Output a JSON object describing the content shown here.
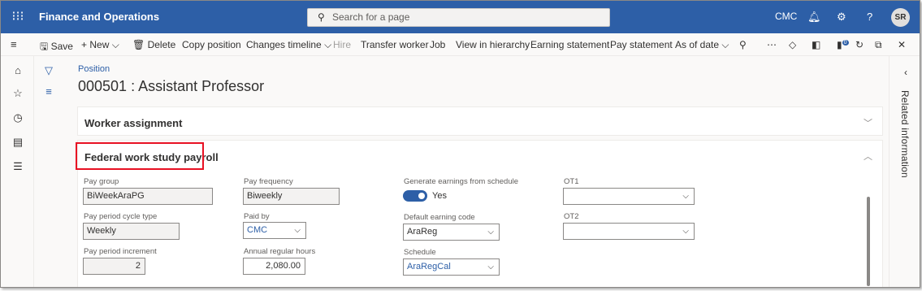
{
  "topbar": {
    "app_name": "Finance and Operations",
    "search_placeholder": "Search for a page",
    "company": "CMC",
    "avatar_initials": "SR",
    "icons": [
      "waffle-icon",
      "search-icon",
      "bell-icon",
      "gear-icon",
      "help-icon"
    ]
  },
  "actionbar": {
    "save": "Save",
    "new": "New",
    "delete": "Delete",
    "copy_position": "Copy position",
    "changes_timeline": "Changes timeline",
    "hire": "Hire",
    "transfer_worker": "Transfer worker",
    "job": "Job",
    "view_in_hierarchy": "View in hierarchy",
    "earning_statement": "Earning statement",
    "pay_statement": "Pay statement",
    "as_of_date": "As of date",
    "badge_count": "0"
  },
  "page": {
    "breadcrumb": "Position",
    "title": "000501 : Assistant Professor"
  },
  "sections": {
    "worker_assignment": "Worker assignment",
    "federal_work_study_payroll": "Federal work study payroll"
  },
  "form": {
    "pay_group_label": "Pay group",
    "pay_group_value": "BiWeekAraPG",
    "pay_frequency_label": "Pay frequency",
    "pay_frequency_value": "Biweekly",
    "generate_earnings_label": "Generate earnings from schedule",
    "generate_earnings_value": "Yes",
    "ot1_label": "OT1",
    "ot1_value": "",
    "pay_period_cycle_type_label": "Pay period cycle type",
    "pay_period_cycle_type_value": "Weekly",
    "paid_by_label": "Paid by",
    "paid_by_value": "CMC",
    "default_earning_code_label": "Default earning code",
    "default_earning_code_value": "AraReg",
    "ot2_label": "OT2",
    "ot2_value": "",
    "pay_period_increment_label": "Pay period increment",
    "pay_period_increment_value": "2",
    "annual_regular_hours_label": "Annual regular hours",
    "annual_regular_hours_value": "2,080.00",
    "schedule_label": "Schedule",
    "schedule_value": "AraRegCal"
  },
  "right_panel": {
    "label": "Related information"
  },
  "colors": {
    "topbar": "#2d5fa7",
    "accent": "#2d5fa7",
    "highlight_box": "#e81123"
  }
}
